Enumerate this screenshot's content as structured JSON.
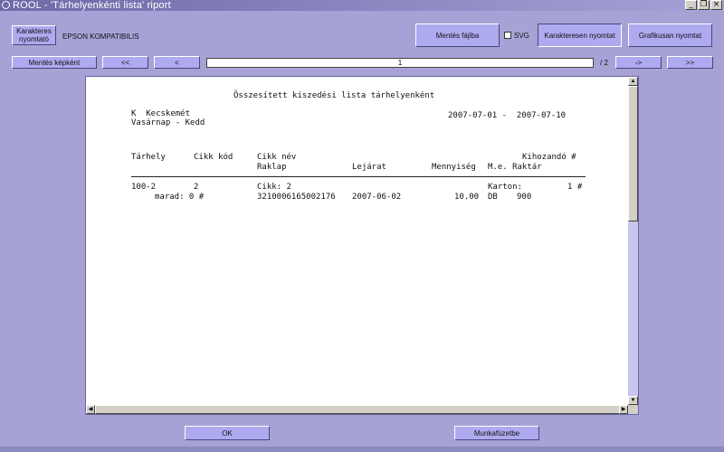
{
  "window": {
    "title": "ROOL  -  'Tárhelyenkénti lista' riport",
    "buttons": {
      "minimize": "_",
      "restore": "❐",
      "close": "×"
    }
  },
  "toolbar": {
    "char_printer_label": "Karakteres nyomtató",
    "printer_name": "EPSON KOMPATIBILIS",
    "save_file_label": "Mentés fájlba",
    "svg_label": "SVG",
    "svg_checked": false,
    "char_print_label": "Karakteresen nyomtat",
    "graphic_print_label": "Grafikusan nyomtat"
  },
  "nav": {
    "save_image_label": "Mentés képként",
    "first_label": "<<",
    "prev_label": "<",
    "page": "1",
    "total": "/ 2",
    "next_label": "->",
    "last_label": ">>"
  },
  "report": {
    "title": "Összesített kiszedési lista tárhelyenként",
    "warehouse": "K  Kecskemét",
    "days": "Vasárnap - Kedd",
    "date_range": "2007-07-01 -  2007-07-10",
    "headers": {
      "location": "Tárhely",
      "item_code": "Cikk kód",
      "item_name": "Cikk név",
      "to_bring": "Kihozandó #",
      "pallet": "Raklap",
      "expiry": "Lejárat",
      "quantity": "Mennyiség",
      "unit_warehouse": "M.e. Raktár"
    },
    "rows": [
      {
        "location": "100-2",
        "item_code": "2",
        "item_name": "Cikk: 2",
        "box_label": "Karton:",
        "box_value": "1 #",
        "remain": "marad: 0 #",
        "pallet": "3210006165002176",
        "expiry": "2007-06-02",
        "quantity": "10.00",
        "unit": "DB",
        "warehouse": "900"
      }
    ]
  },
  "footer": {
    "ok_label": "OK",
    "workbook_label": "Munkafüzetbe"
  }
}
